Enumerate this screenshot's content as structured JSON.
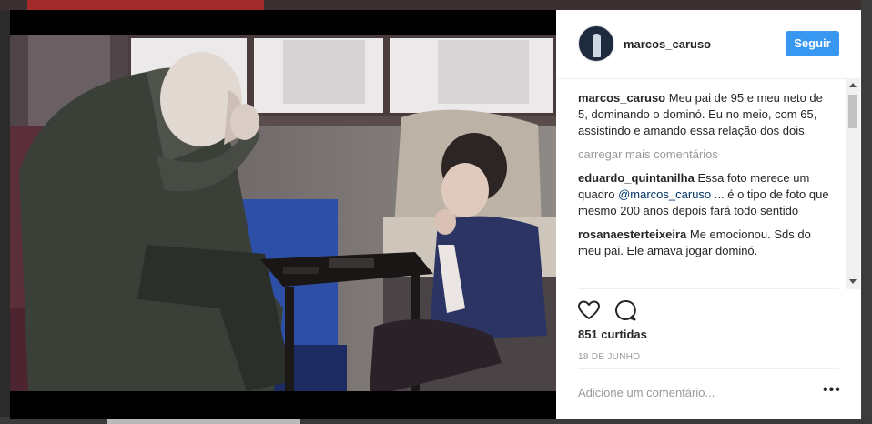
{
  "post": {
    "photo_alt": "",
    "header": {
      "username": "marcos_caruso",
      "follow_label": "Seguir"
    },
    "caption": {
      "username": "marcos_caruso",
      "text": "Meu pai de 95 e meu neto de 5, dominando o dominó. Eu no meio, com 65, assistindo e amando essa relação dos dois."
    },
    "load_more_label": "carregar mais comentários",
    "comments": [
      {
        "username": "eduardo_quintanilha",
        "text_before": "Essa foto merece um quadro ",
        "mention": "@marcos_caruso",
        "text_after": " ... é o tipo de foto que mesmo 200 anos depois fará todo sentido"
      },
      {
        "username": "rosanaesterteixeira",
        "text": "Me emocionou. Sds do meu pai. Ele amava jogar dominó."
      }
    ],
    "likes_label": "851 curtidas",
    "date_label": "18 DE JUNHO",
    "add_comment_placeholder": "Adicione um comentário...",
    "more_options_label": "•••"
  },
  "icons": {
    "like": "heart-icon",
    "comment": "comment-bubble-icon",
    "more": "more-options-icon"
  },
  "colors": {
    "follow_button": "#3897f0",
    "mention": "#003569",
    "muted_text": "#999999"
  }
}
